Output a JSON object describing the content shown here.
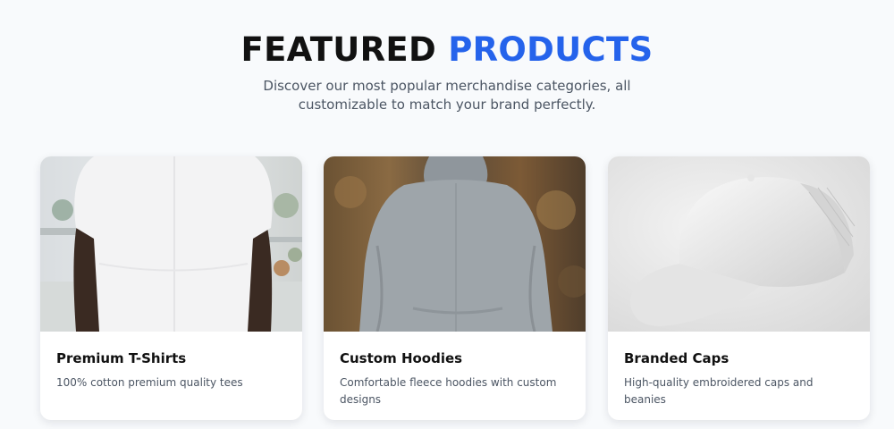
{
  "section": {
    "title_part1": "FEATURED",
    "title_part2": "PRODUCTS",
    "subtitle": "Discover our most popular merchandise categories, all customizable to match your brand perfectly."
  },
  "products": [
    {
      "name": "Premium T-Shirts",
      "description": "100% cotton premium quality tees",
      "image": "white-tshirt-image"
    },
    {
      "name": "Custom Hoodies",
      "description": "Comfortable fleece hoodies with custom designs",
      "image": "grey-hoodie-image"
    },
    {
      "name": "Branded Caps",
      "description": "High-quality embroidered caps and beanies",
      "image": "white-cap-image"
    }
  ],
  "colors": {
    "accent": "#2563eb",
    "background": "#f8fafc",
    "card": "#ffffff"
  }
}
